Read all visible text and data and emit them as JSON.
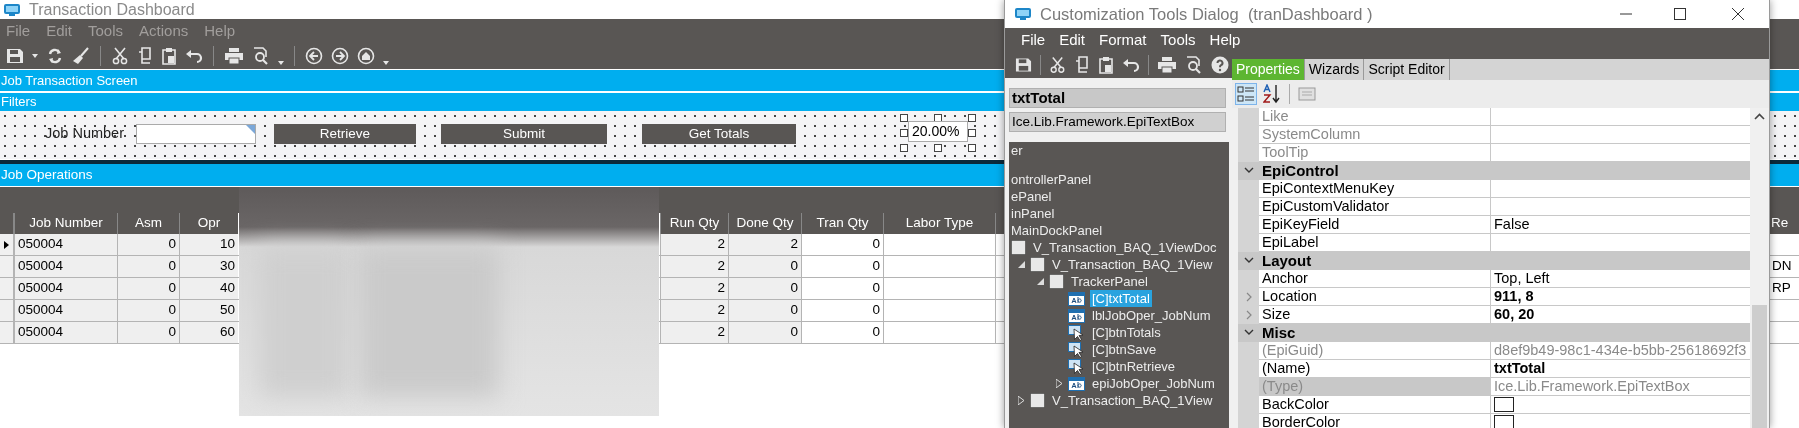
{
  "main_window": {
    "title": "Transaction Dashboard",
    "menu": [
      {
        "label": "File",
        "disabled": true
      },
      {
        "label": "Edit",
        "disabled": true
      },
      {
        "label": "Tools",
        "disabled": true
      },
      {
        "label": "Actions",
        "disabled": true
      },
      {
        "label": "Help",
        "disabled": true
      }
    ],
    "sections": [
      "Job Transaction Screen",
      "Filters"
    ],
    "filters": {
      "job_number_label": "Job Number",
      "retrieve_button": "Retrieve",
      "submit_button": "Submit",
      "totals_button": "Get Totals",
      "total_value": "20.00%"
    },
    "grid_title": "Job Operations",
    "grid": {
      "columns": [
        {
          "label": "Job Number",
          "editable": false
        },
        {
          "label": "Asm",
          "editable": false
        },
        {
          "label": "Opr",
          "editable": false
        },
        {
          "label": "Run Qty",
          "editable": false
        },
        {
          "label": "Done Qty",
          "editable": false
        },
        {
          "label": "Tran Qty",
          "editable": true
        },
        {
          "label": "Labor Type",
          "editable": true
        },
        {
          "label": "Re",
          "editable": true
        }
      ],
      "rows": [
        {
          "selected": true,
          "cells": [
            "050004",
            "0",
            "10",
            "2",
            "2",
            "0",
            null,
            null
          ]
        },
        {
          "selected": false,
          "cells": [
            "050004",
            "0",
            "30",
            "2",
            "0",
            "0",
            null,
            "DN"
          ]
        },
        {
          "selected": false,
          "cells": [
            "050004",
            "0",
            "40",
            "2",
            "0",
            "0",
            null,
            "RP"
          ]
        },
        {
          "selected": false,
          "cells": [
            "050004",
            "0",
            "50",
            "2",
            "0",
            "0",
            null,
            null
          ]
        },
        {
          "selected": false,
          "cells": [
            "050004",
            "0",
            "60",
            "2",
            "0",
            "0",
            null,
            null
          ]
        }
      ]
    }
  },
  "dialog": {
    "title": "Customization Tools Dialog  (tranDashboard )",
    "menu": [
      "File",
      "Edit",
      "Format",
      "Tools",
      "Help"
    ],
    "control_name": "txtTotal",
    "control_type": "Ice.Lib.Framework.EpiTextBox",
    "tree": [
      {
        "label": "er",
        "kind": "text_only",
        "selected": false
      },
      {
        "label": "ontrollerPanel",
        "kind": "text_only",
        "selected": false
      },
      {
        "label": "ePanel",
        "kind": "text_only",
        "selected": false
      },
      {
        "label": "inPanel",
        "kind": "text_only",
        "selected": false
      },
      {
        "label": "MainDockPanel",
        "kind": "text_only",
        "selected": false
      },
      {
        "label": "V_Transaction_BAQ_1ViewDoc",
        "kind": "container",
        "selected": false,
        "children": [
          {
            "label": "V_Transaction_BAQ_1View",
            "kind": "container",
            "selected": false,
            "expanded": true,
            "children": [
              {
                "label": "TrackerPanel",
                "kind": "container",
                "selected": false,
                "expanded": true,
                "children": [
                  {
                    "label": "[C]txtTotal",
                    "kind": "textbox",
                    "selected": true
                  },
                  {
                    "label": "lblJobOper_JobNum",
                    "kind": "textbox",
                    "selected": false
                  },
                  {
                    "label": "[C]btnTotals",
                    "kind": "button",
                    "selected": false
                  },
                  {
                    "label": "[C]btnSave",
                    "kind": "button",
                    "selected": false
                  },
                  {
                    "label": "[C]btnRetrieve",
                    "kind": "button",
                    "selected": false
                  },
                  {
                    "label": "epiJobOper_JobNum",
                    "kind": "textbox",
                    "selected": false,
                    "expanded": false
                  }
                ]
              }
            ]
          },
          {
            "label": "V_Transaction_BAQ_1View",
            "kind": "container",
            "selected": false,
            "expanded": false
          }
        ]
      }
    ],
    "tabs": [
      {
        "label": "Properties",
        "selected": true
      },
      {
        "label": "Wizards",
        "selected": false
      },
      {
        "label": "Script Editor",
        "selected": false
      }
    ],
    "properties": [
      {
        "kind": "property",
        "name": "Like",
        "readonly": true,
        "selected": false
      },
      {
        "kind": "property",
        "name": "SystemColumn",
        "readonly": true,
        "selected": false
      },
      {
        "kind": "property",
        "name": "ToolTip",
        "readonly": true,
        "selected": false
      },
      {
        "kind": "category",
        "name": "EpiControl",
        "expanded": true
      },
      {
        "kind": "property",
        "name": "EpiContextMenuKey",
        "readonly": false,
        "selected": false
      },
      {
        "kind": "property",
        "name": "EpiCustomValidator",
        "readonly": false,
        "selected": false
      },
      {
        "kind": "property",
        "name": "EpiKeyField",
        "value": "False",
        "readonly": false,
        "selected": false
      },
      {
        "kind": "property",
        "name": "EpiLabel",
        "readonly": false,
        "selected": false
      },
      {
        "kind": "category",
        "name": "Layout",
        "expanded": true
      },
      {
        "kind": "property",
        "name": "Anchor",
        "value": "Top, Left",
        "readonly": false,
        "selected": false
      },
      {
        "kind": "property",
        "name": "Location",
        "value": "911, 8",
        "readonly": false,
        "modified": true,
        "expanded": false,
        "selected": false
      },
      {
        "kind": "property",
        "name": "Size",
        "value": "60, 20",
        "readonly": false,
        "modified": true,
        "expanded": false,
        "selected": false
      },
      {
        "kind": "category",
        "name": "Misc",
        "expanded": true
      },
      {
        "kind": "property",
        "name": "(EpiGuid)",
        "value": "d8ef9b49-98c1-434e-b5bb-25618692f3",
        "readonly": true,
        "selected": false
      },
      {
        "kind": "property",
        "name": "(Name)",
        "value": "txtTotal",
        "readonly": false,
        "modified": true,
        "selected": false
      },
      {
        "kind": "property",
        "name": "(Type)",
        "value": "Ice.Lib.Framework.EpiTextBox",
        "readonly": true,
        "selected": true
      },
      {
        "kind": "property",
        "name": "BackColor",
        "color": "#ffffff",
        "readonly": false,
        "selected": false
      },
      {
        "kind": "property",
        "name": "BorderColor",
        "color": "#ffffff",
        "readonly": false,
        "selected": false
      }
    ]
  }
}
